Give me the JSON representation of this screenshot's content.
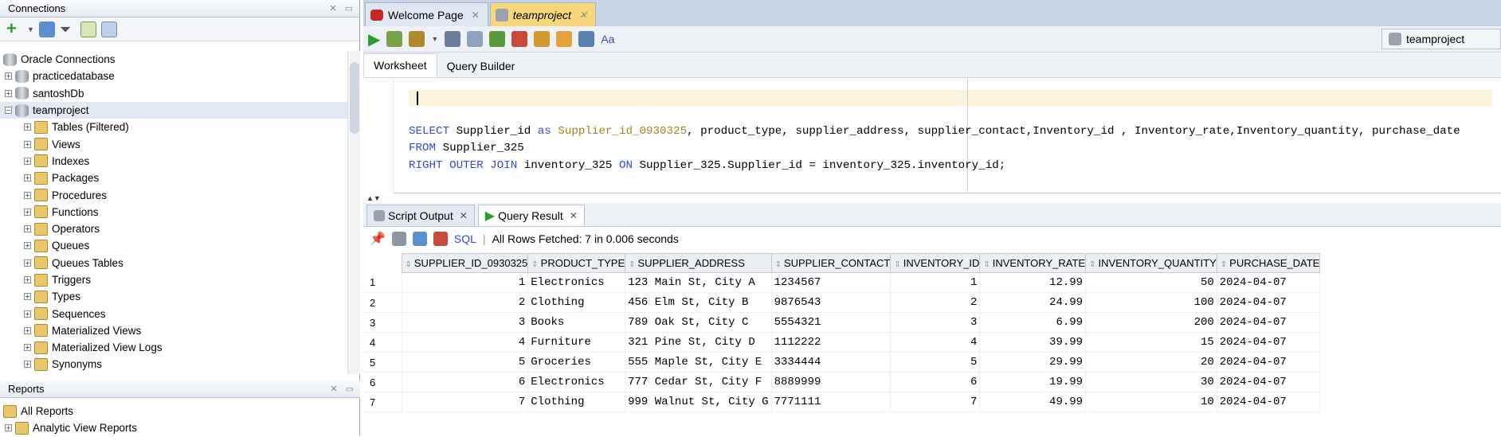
{
  "connections_panel": {
    "title": "Connections",
    "tree": [
      {
        "label": "Oracle Connections",
        "level": 0,
        "icon": "db-folder-icon",
        "toggle": ""
      },
      {
        "label": "practicedatabase",
        "level": 1,
        "icon": "database-icon",
        "toggle": "+"
      },
      {
        "label": "santoshDb",
        "level": 1,
        "icon": "database-icon",
        "toggle": "+"
      },
      {
        "label": "teamproject",
        "level": 1,
        "icon": "database-connected-icon",
        "toggle": "-"
      },
      {
        "label": "Tables (Filtered)",
        "level": 2,
        "icon": "folder-icon",
        "toggle": "+"
      },
      {
        "label": "Views",
        "level": 2,
        "icon": "folder-icon",
        "toggle": "+"
      },
      {
        "label": "Indexes",
        "level": 2,
        "icon": "folder-icon",
        "toggle": "+"
      },
      {
        "label": "Packages",
        "level": 2,
        "icon": "folder-icon",
        "toggle": "+"
      },
      {
        "label": "Procedures",
        "level": 2,
        "icon": "folder-icon",
        "toggle": "+"
      },
      {
        "label": "Functions",
        "level": 2,
        "icon": "folder-icon",
        "toggle": "+"
      },
      {
        "label": "Operators",
        "level": 2,
        "icon": "folder-icon",
        "toggle": "+"
      },
      {
        "label": "Queues",
        "level": 2,
        "icon": "folder-icon",
        "toggle": "+"
      },
      {
        "label": "Queues Tables",
        "level": 2,
        "icon": "folder-icon",
        "toggle": "+"
      },
      {
        "label": "Triggers",
        "level": 2,
        "icon": "folder-icon",
        "toggle": "+"
      },
      {
        "label": "Types",
        "level": 2,
        "icon": "folder-icon",
        "toggle": "+"
      },
      {
        "label": "Sequences",
        "level": 2,
        "icon": "folder-icon",
        "toggle": "+"
      },
      {
        "label": "Materialized Views",
        "level": 2,
        "icon": "folder-icon",
        "toggle": "+"
      },
      {
        "label": "Materialized View Logs",
        "level": 2,
        "icon": "folder-icon",
        "toggle": "+"
      },
      {
        "label": "Synonyms",
        "level": 2,
        "icon": "folder-icon",
        "toggle": "+"
      }
    ]
  },
  "reports_panel": {
    "title": "Reports",
    "items": [
      {
        "label": "All Reports"
      },
      {
        "label": "Analytic View Reports"
      }
    ]
  },
  "doc_tabs": [
    {
      "label": "Welcome Page"
    },
    {
      "label": "teamproject"
    }
  ],
  "connection_selector": "teamproject",
  "sub_tabs": [
    "Worksheet",
    "Query Builder"
  ],
  "sql": {
    "line1": {
      "kw1": "SELECT",
      "t1": " Supplier_id ",
      "kw2": "as",
      "alias": " Supplier_id_0930325",
      "t2": ", product_type, supplier_address, supplier_contact,Inventory_id , Inventory_rate,Inventory_quantity, purchase_date"
    },
    "line2": {
      "kw": "FROM",
      "t": " Supplier_325"
    },
    "line3": {
      "kw1": "RIGHT OUTER JOIN",
      "t1": " inventory_325 ",
      "kw2": "ON",
      "t2": " Supplier_325.Supplier_id = inventory_325.inventory_id;"
    }
  },
  "output_tabs": [
    "Script Output",
    "Query Result"
  ],
  "result_toolbar": {
    "sql_label": "SQL",
    "status": "All Rows Fetched: 7 in 0.006 seconds"
  },
  "results": {
    "columns": [
      "SUPPLIER_ID_0930325",
      "PRODUCT_TYPE",
      "SUPPLIER_ADDRESS",
      "SUPPLIER_CONTACT",
      "INVENTORY_ID",
      "INVENTORY_RATE",
      "INVENTORY_QUANTITY",
      "PURCHASE_DATE"
    ],
    "rows": [
      [
        "1",
        "1",
        "Electronics",
        "123 Main St, City A",
        "1234567",
        "1",
        "12.99",
        "50",
        "2024-04-07"
      ],
      [
        "2",
        "2",
        "Clothing",
        "456 Elm St, City B",
        "9876543",
        "2",
        "24.99",
        "100",
        "2024-04-07"
      ],
      [
        "3",
        "3",
        "Books",
        "789 Oak St, City C",
        "5554321",
        "3",
        "6.99",
        "200",
        "2024-04-07"
      ],
      [
        "4",
        "4",
        "Furniture",
        "321 Pine St, City D",
        "1112222",
        "4",
        "39.99",
        "15",
        "2024-04-07"
      ],
      [
        "5",
        "5",
        "Groceries",
        "555 Maple St, City E",
        "3334444",
        "5",
        "29.99",
        "20",
        "2024-04-07"
      ],
      [
        "6",
        "6",
        "Electronics",
        "777 Cedar St, City F",
        "8889999",
        "6",
        "19.99",
        "30",
        "2024-04-07"
      ],
      [
        "7",
        "7",
        "Clothing",
        "999 Walnut St, City G",
        "7771111",
        "7",
        "49.99",
        "10",
        "2024-04-07"
      ]
    ]
  }
}
